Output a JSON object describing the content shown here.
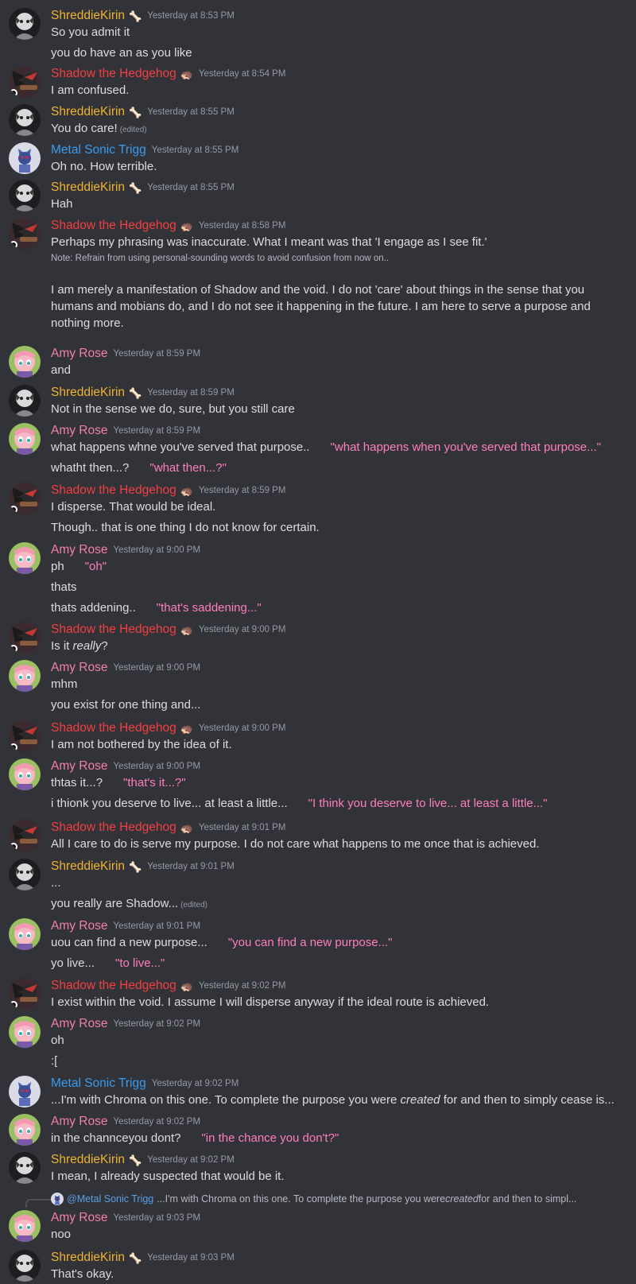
{
  "users": {
    "shreddie": {
      "name": "ShreddieKirin",
      "color": "#f0b232",
      "badge": "🦴"
    },
    "shadow": {
      "name": "Shadow the Hedgehog",
      "color": "#f23f42",
      "badge": "🦔"
    },
    "metal": {
      "name": "Metal Sonic Trigg",
      "color": "#3a9bf0",
      "badge": ""
    },
    "amy": {
      "name": "Amy Rose",
      "color": "#f47fac",
      "badge": ""
    }
  },
  "messages": [
    {
      "user": "ShreddieKirin",
      "time": "Yesterday at 8:53 PM",
      "lines": [
        "So you admit it",
        "you do have an as you like"
      ]
    },
    {
      "user": "Shadow the Hedgehog",
      "time": "Yesterday at 8:54 PM",
      "lines": [
        "I am confused."
      ]
    },
    {
      "user": "ShreddieKirin",
      "time": "Yesterday at 8:55 PM",
      "lines": [
        "You do care!"
      ],
      "edited": "(edited)"
    },
    {
      "user": "Metal Sonic Trigg",
      "time": "Yesterday at 8:55 PM",
      "lines": [
        "Oh no. How terrible."
      ]
    },
    {
      "user": "ShreddieKirin",
      "time": "Yesterday at 8:55 PM",
      "lines": [
        "Hah"
      ]
    },
    {
      "user": "Shadow the Hedgehog",
      "time": "Yesterday at 8:58 PM",
      "lines": [
        "Perhaps my phrasing was inaccurate. What I meant was that 'I engage as I see fit.'"
      ],
      "note": "Note: Refrain from using personal-sounding words to avoid confusion from now on..",
      "paragraph": "I am merely a manifestation of Shadow and the void. I do not 'care' about things in the sense that you humans and mobians do, and I do not see it happening in the future. I am here to serve a purpose and nothing more."
    },
    {
      "user": "Amy Rose",
      "time": "Yesterday at 8:59 PM",
      "lines": [
        "and"
      ]
    },
    {
      "user": "ShreddieKirin",
      "time": "Yesterday at 8:59 PM",
      "lines": [
        "Not in the sense we do, sure, but you still care"
      ]
    },
    {
      "user": "Amy Rose",
      "time": "Yesterday at 8:59 PM",
      "lines": [
        "what happens whne you've served that purpose..",
        "whatht then...?"
      ],
      "translations": [
        "\"what happens when you've served that purpose...\"",
        "\"what then...?\""
      ]
    },
    {
      "user": "Shadow the Hedgehog",
      "time": "Yesterday at 8:59 PM",
      "lines": [
        "I disperse. That would be ideal.",
        "Though.. that is one thing I do not know for certain."
      ]
    },
    {
      "user": "Amy Rose",
      "time": "Yesterday at 9:00 PM",
      "lines": [
        "ph",
        "thats",
        "thats addening.."
      ],
      "translations": [
        "\"oh\"",
        "",
        "\"that's saddening...\""
      ]
    },
    {
      "user": "Shadow the Hedgehog",
      "time": "Yesterday at 9:00 PM",
      "lines": [
        "Is it ",
        "?"
      ],
      "emph": "really"
    },
    {
      "user": "Amy Rose",
      "time": "Yesterday at 9:00 PM",
      "lines": [
        "mhm",
        "you exist for one thing and..."
      ]
    },
    {
      "user": "Shadow the Hedgehog",
      "time": "Yesterday at 9:00 PM",
      "lines": [
        "I am not bothered by the idea of it."
      ]
    },
    {
      "user": "Amy Rose",
      "time": "Yesterday at 9:00 PM",
      "lines": [
        "thtas it...?",
        "i thionk you deserve to live... at least a little..."
      ],
      "translations": [
        "\"that's it...?\"",
        "\"I think you deserve to live... at least a little...\""
      ]
    },
    {
      "user": "Shadow the Hedgehog",
      "time": "Yesterday at 9:01 PM",
      "lines": [
        "All I care to do is serve my purpose. I do not care what happens to me once that is achieved."
      ]
    },
    {
      "user": "ShreddieKirin",
      "time": "Yesterday at 9:01 PM",
      "lines": [
        "...",
        "you really are Shadow..."
      ],
      "edited": "(edited)"
    },
    {
      "user": "Amy Rose",
      "time": "Yesterday at 9:01 PM",
      "lines": [
        "uou can find a new purpose...",
        "yo live..."
      ],
      "translations": [
        "\"you can find a new purpose...\"",
        "\"to live...\""
      ]
    },
    {
      "user": "Shadow the Hedgehog",
      "time": "Yesterday at 9:02 PM",
      "lines": [
        "I exist within the void. I assume I will disperse anyway if the ideal route is achieved."
      ]
    },
    {
      "user": "Amy Rose",
      "time": "Yesterday at 9:02 PM",
      "lines": [
        "oh",
        ":["
      ]
    },
    {
      "user": "Metal Sonic Trigg",
      "time": "Yesterday at 9:02 PM",
      "lines": [
        "...I'm with Chroma on this one. To complete the purpose you were ",
        " for and then to simply cease is..."
      ],
      "emph": "created"
    },
    {
      "user": "Amy Rose",
      "time": "Yesterday at 9:02 PM",
      "lines": [
        "in the channceyou dont?"
      ],
      "translations": [
        "\"in the chance you don't?\""
      ]
    },
    {
      "user": "ShreddieKirin",
      "time": "Yesterday at 9:02 PM",
      "lines": [
        "I mean, I already suspected that would be it."
      ]
    },
    {
      "user": "Amy Rose",
      "time": "Yesterday at 9:03 PM",
      "lines": [
        "noo"
      ],
      "reply": {
        "mention": "@Metal Sonic Trigg",
        "pre": "...I'm with Chroma on this one. To complete the purpose you were ",
        "emph": "created",
        "post": " for and then to simpl..."
      }
    },
    {
      "user": "ShreddieKirin",
      "time": "Yesterday at 9:03 PM",
      "lines": [
        "That's okay."
      ]
    }
  ]
}
